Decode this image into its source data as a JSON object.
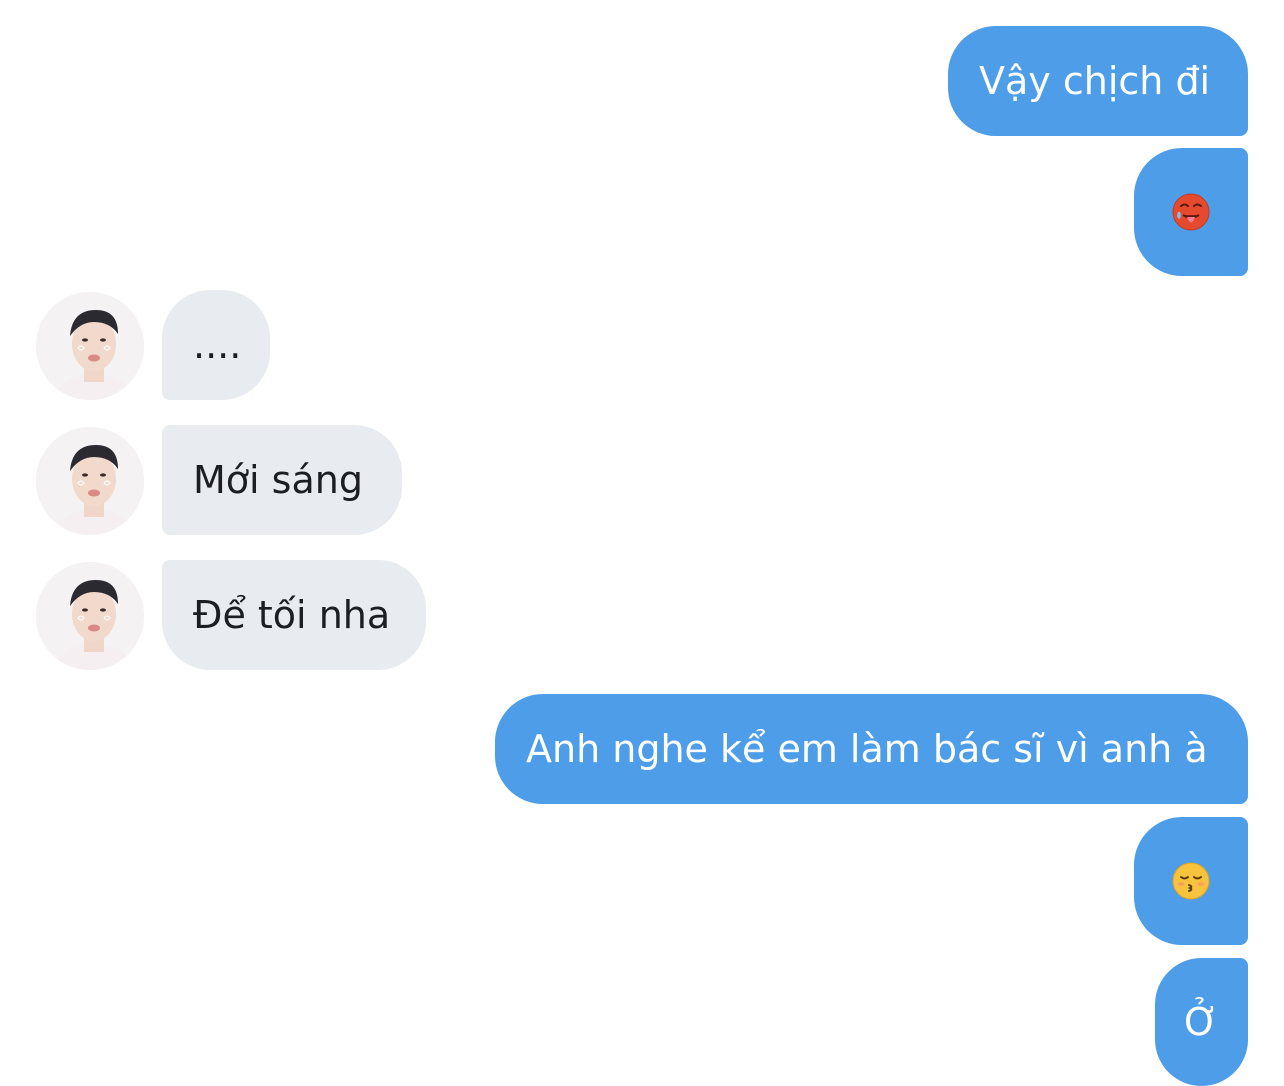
{
  "conversation": {
    "messages": [
      {
        "direction": "outgoing",
        "type": "text",
        "text": "Vậy chịch đi"
      },
      {
        "direction": "outgoing",
        "type": "emoji",
        "emoji": "hot-face-emoji"
      },
      {
        "direction": "incoming",
        "type": "text",
        "text": "...."
      },
      {
        "direction": "incoming",
        "type": "text",
        "text": "Mới sáng"
      },
      {
        "direction": "incoming",
        "type": "text",
        "text": "Để tối nha"
      },
      {
        "direction": "outgoing",
        "type": "text",
        "text": "Anh nghe kể em làm bác sĩ vì anh à"
      },
      {
        "direction": "outgoing",
        "type": "emoji",
        "emoji": "kissing-face-with-closed-eyes-emoji"
      },
      {
        "direction": "outgoing",
        "type": "text",
        "text": "Ở"
      }
    ]
  },
  "colors": {
    "outgoing_bubble": "#4e9de8",
    "incoming_bubble": "#e8ebef",
    "background": "#ffffff"
  }
}
